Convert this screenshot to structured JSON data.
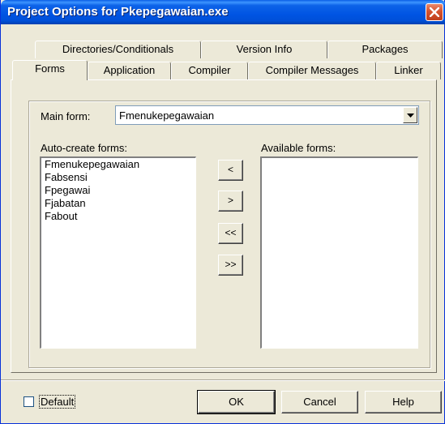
{
  "window": {
    "title": "Project Options for Pkepegawaian.exe"
  },
  "tabs": {
    "back_row": [
      "Directories/Conditionals",
      "Version Info",
      "Packages"
    ],
    "front_row": [
      "Forms",
      "Application",
      "Compiler",
      "Compiler Messages",
      "Linker"
    ],
    "active": "Forms"
  },
  "forms": {
    "main_form_label": "Main form:",
    "main_form_value": "Fmenukepegawaian",
    "auto_create_label": "Auto-create forms:",
    "auto_create_items": [
      "Fmenukepegawaian",
      "Fabsensi",
      "Fpegawai",
      "Fjabatan",
      "Fabout"
    ],
    "available_label": "Available forms:",
    "available_items": [],
    "move_buttons": [
      "<",
      ">",
      "<<",
      ">>"
    ]
  },
  "footer": {
    "default_label": "Default",
    "default_checked": false,
    "ok_label": "OK",
    "cancel_label": "Cancel",
    "help_label": "Help"
  },
  "icons": {
    "close": "close-icon",
    "dropdown": "chevron-down-icon"
  }
}
